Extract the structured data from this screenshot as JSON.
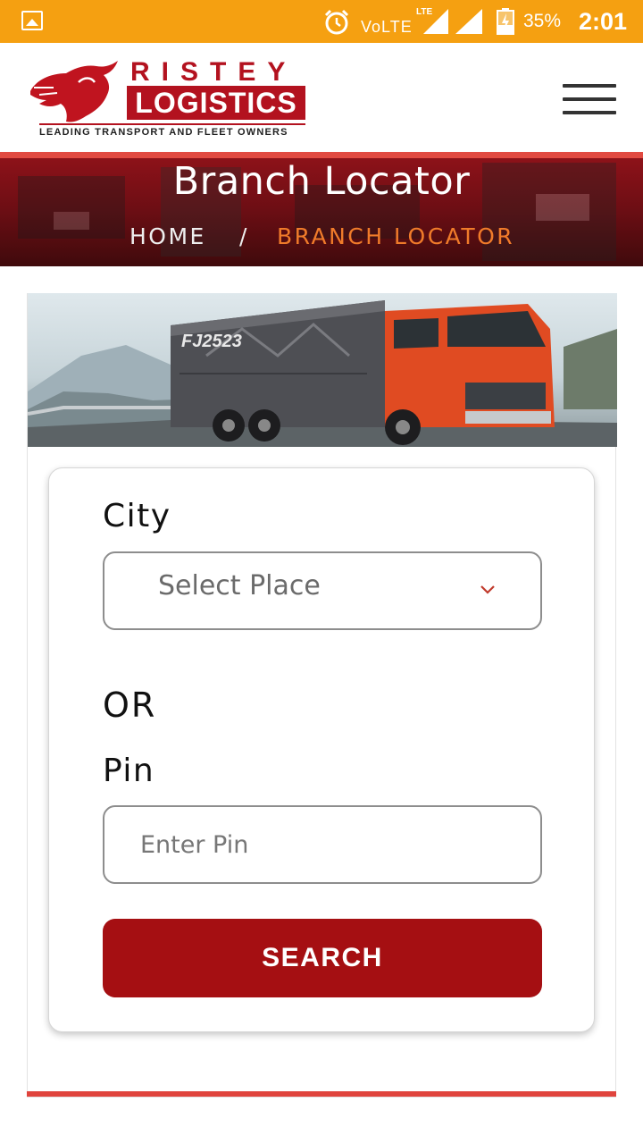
{
  "status_bar": {
    "network": "VoLTE",
    "network_sub": "LTE",
    "battery_pct": "35%",
    "time": "2:01"
  },
  "header": {
    "logo_name_top": "RISTEY",
    "logo_name_bottom": "LOGISTICS",
    "logo_tagline": "LEADING TRANSPORT AND FLEET OWNERS",
    "menu_icon": "hamburger-menu-icon"
  },
  "banner": {
    "title": "Branch Locator",
    "breadcrumb": {
      "home": "HOME",
      "separator": "/",
      "current": "BRANCH LOCATOR"
    }
  },
  "hero": {
    "truck_plate": "FJ2523"
  },
  "form": {
    "city_label": "City",
    "city_select": {
      "selected": "Select Place"
    },
    "or_label": "OR",
    "pin_label": "Pin",
    "pin_input": {
      "value": "",
      "placeholder": "Enter Pin"
    },
    "search_label": "SEARCH"
  },
  "colors": {
    "status_bar": "#f5a011",
    "brand_red": "#b3121f",
    "button": "#a50f12",
    "breadcrumb_active": "#f07b2a",
    "rule": "#e0443d"
  }
}
